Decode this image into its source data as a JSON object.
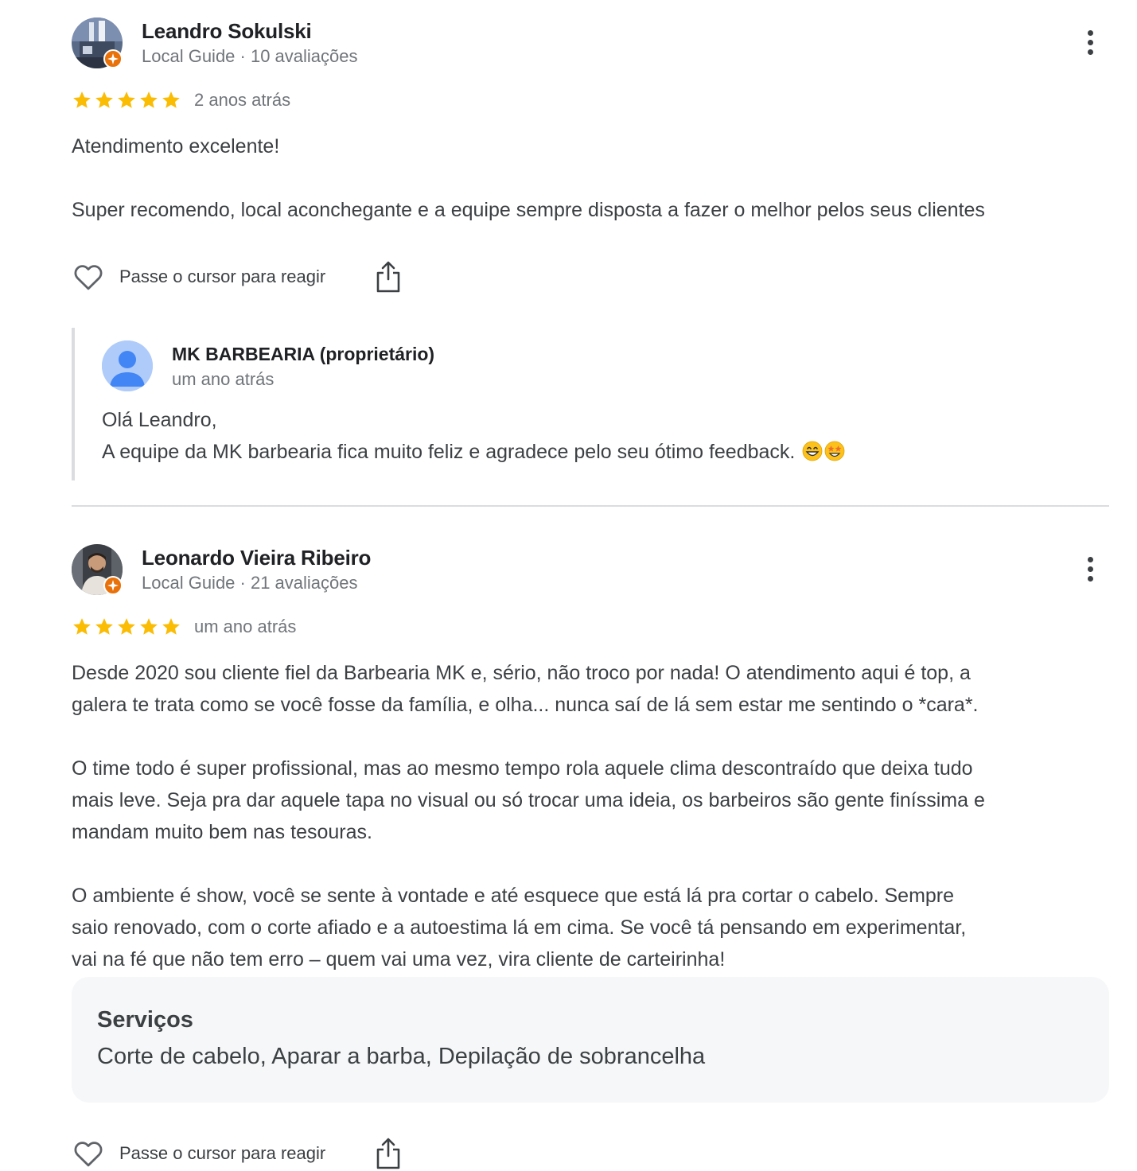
{
  "reviews": [
    {
      "author": "Leandro Sokulski",
      "meta": "Local Guide · 10 avaliações",
      "rating": 5,
      "max_rating": 5,
      "date": "2 anos atrás",
      "text": "Atendimento excelente!\n\nSuper recomendo, local aconchegante e a equipe sempre disposta a fazer o melhor pelos seus clientes",
      "react_label": "Passe o cursor para reagir",
      "owner_reply": {
        "name": "MK BARBEARIA (proprietário)",
        "date": "um ano atrás",
        "text": "Olá Leandro,\nA equipe da MK barbearia fica muito feliz e agradece pelo seu ótimo feedback."
      }
    },
    {
      "author": "Leonardo Vieira Ribeiro",
      "meta": "Local Guide · 21 avaliações",
      "rating": 5,
      "max_rating": 5,
      "date": "um ano atrás",
      "text": "Desde 2020 sou cliente fiel da Barbearia MK e, sério, não troco por nada! O atendimento aqui é top, a\ngalera te trata como se você fosse da família, e olha... nunca saí de lá sem estar me sentindo o *cara*.\n\nO time todo é super profissional, mas ao mesmo tempo rola aquele clima descontraído que deixa tudo\nmais leve. Seja pra dar aquele tapa no visual ou só trocar uma ideia, os barbeiros são gente finíssima e\nmandam muito bem nas tesouras.\n\nO ambiente é show, você se sente à vontade e até esquece que está lá pra cortar o cabelo. Sempre\nsaio renovado, com o corte afiado e a autoestima lá em cima. Se você tá pensando em experimentar,\nvai na fé que não tem erro – quem vai uma vez, vira cliente de carteirinha!",
      "services": {
        "title": "Serviços",
        "value": "Corte de cabelo, Aparar a barba, Depilação de sobrancelha"
      },
      "react_label": "Passe o cursor para reagir"
    }
  ],
  "colors": {
    "star": "#fbbc04",
    "badge": "#e8710a",
    "muted_text": "#70757a",
    "divider": "#dadce0",
    "services_bg": "#f6f7f9"
  },
  "icons": [
    "more-vert-icon",
    "heart-icon",
    "share-icon",
    "star-icon",
    "local-guide-badge-icon",
    "default-avatar-icon",
    "grinning-emoji",
    "star-struck-emoji"
  ]
}
